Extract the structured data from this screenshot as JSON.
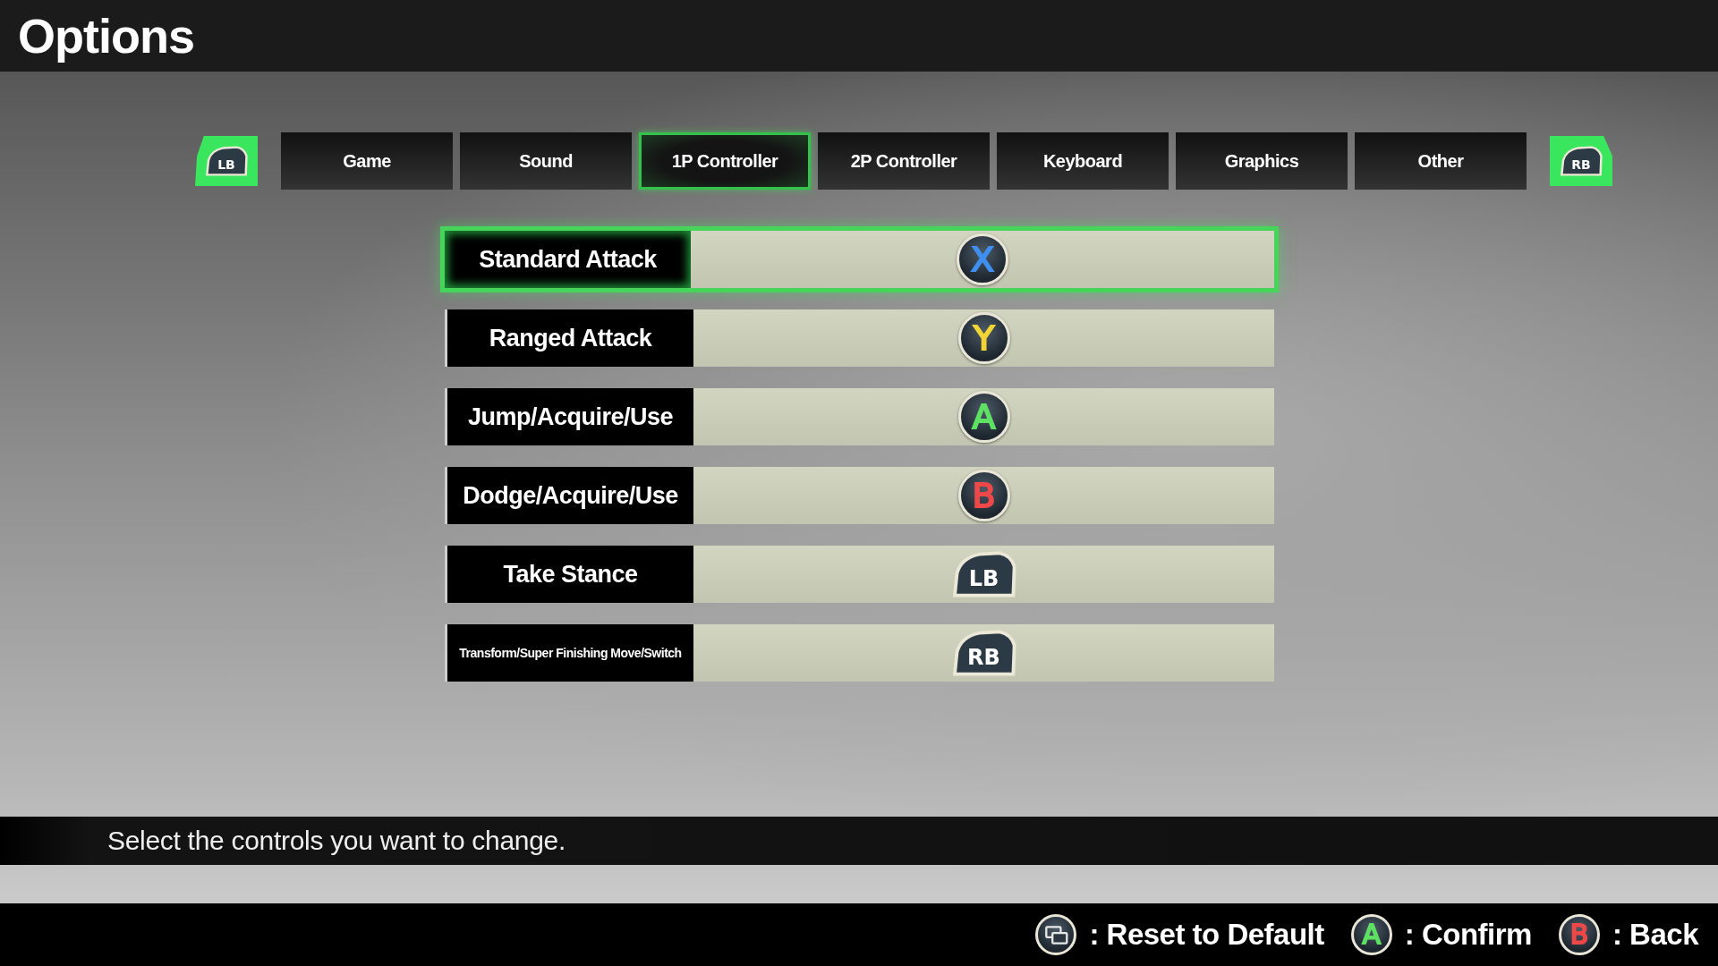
{
  "window": {
    "title": "Options"
  },
  "tab_bar": {
    "prev_button": "LB",
    "next_button": "RB"
  },
  "tabs": [
    {
      "label": "Game",
      "selected": false
    },
    {
      "label": "Sound",
      "selected": false
    },
    {
      "label": "1P Controller",
      "selected": true
    },
    {
      "label": "2P Controller",
      "selected": false
    },
    {
      "label": "Keyboard",
      "selected": false
    },
    {
      "label": "Graphics",
      "selected": false
    },
    {
      "label": "Other",
      "selected": false
    }
  ],
  "bindings": [
    {
      "action": "Standard Attack",
      "selected": true,
      "button": {
        "kind": "face",
        "label": "X",
        "color": "#3f8ff0"
      }
    },
    {
      "action": "Ranged Attack",
      "selected": false,
      "button": {
        "kind": "face",
        "label": "Y",
        "color": "#f2d436"
      }
    },
    {
      "action": "Jump/Acquire/Use",
      "selected": false,
      "button": {
        "kind": "face",
        "label": "A",
        "color": "#5ee063"
      }
    },
    {
      "action": "Dodge/Acquire/Use",
      "selected": false,
      "button": {
        "kind": "face",
        "label": "B",
        "color": "#ee4848"
      }
    },
    {
      "action": "Take Stance",
      "selected": false,
      "button": {
        "kind": "bumper",
        "label": "LB"
      }
    },
    {
      "action": "Transform/Super Finishing Move/Switch",
      "selected": false,
      "button": {
        "kind": "bumper",
        "label": "RB"
      }
    }
  ],
  "status_bar": {
    "message": "Select the controls you want to change."
  },
  "footer": {
    "actions": [
      {
        "button": {
          "kind": "view"
        },
        "label": ": Reset to Default"
      },
      {
        "button": {
          "kind": "face",
          "label": "A",
          "color": "#5ee063"
        },
        "label": ": Confirm"
      },
      {
        "button": {
          "kind": "face",
          "label": "B",
          "color": "#ee4848"
        },
        "label": ": Back"
      }
    ]
  }
}
